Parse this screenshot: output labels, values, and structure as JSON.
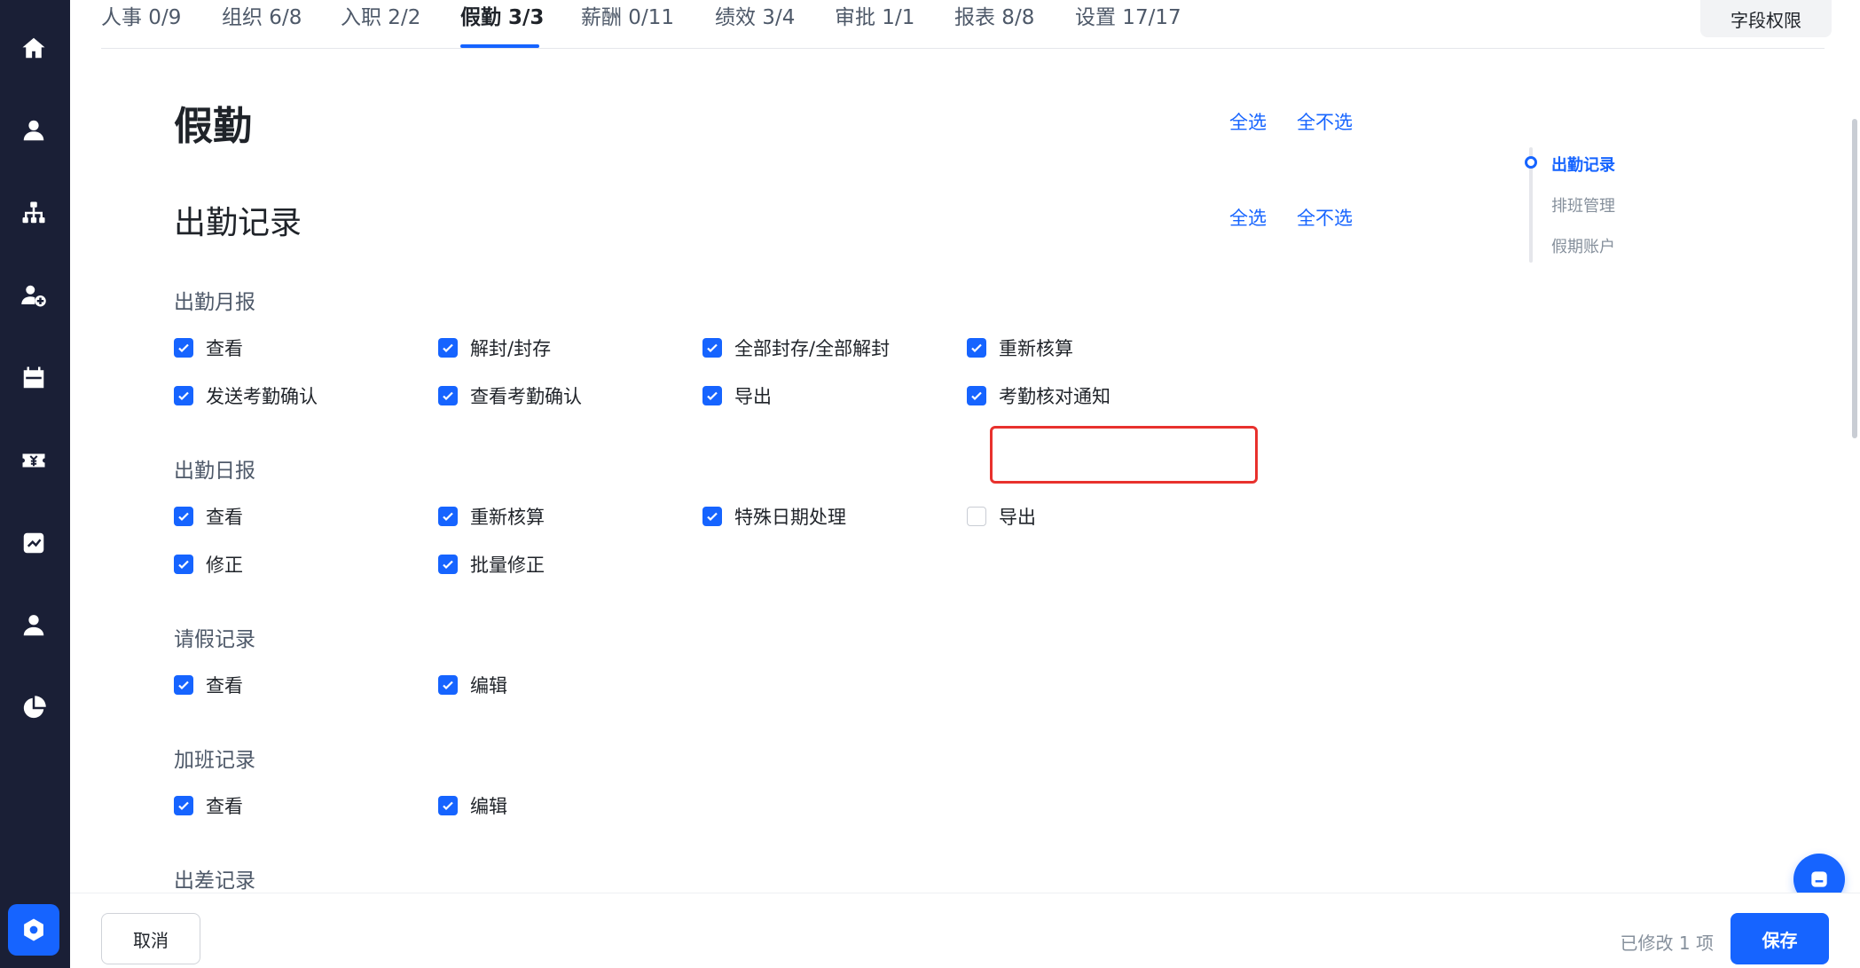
{
  "tabs": [
    {
      "label": "人事 0/9"
    },
    {
      "label": "组织 6/8"
    },
    {
      "label": "入职 2/2"
    },
    {
      "label": "假勤 3/3"
    },
    {
      "label": "薪酬 0/11"
    },
    {
      "label": "绩效 3/4"
    },
    {
      "label": "审批 1/1"
    },
    {
      "label": "报表 8/8"
    },
    {
      "label": "设置 17/17"
    }
  ],
  "active_tab": "假勤 3/3",
  "field_permission_label": "字段权限",
  "page": {
    "title": "假勤",
    "select_all": "全选",
    "select_none": "全不选"
  },
  "section": {
    "title": "出勤记录",
    "select_all": "全选",
    "select_none": "全不选"
  },
  "groups": [
    {
      "title": "出勤月报",
      "items": [
        {
          "label": "查看",
          "checked": true
        },
        {
          "label": "解封/封存",
          "checked": true
        },
        {
          "label": "全部封存/全部解封",
          "checked": true
        },
        {
          "label": "重新核算",
          "checked": true
        },
        {
          "label": "发送考勤确认",
          "checked": true
        },
        {
          "label": "查看考勤确认",
          "checked": true
        },
        {
          "label": "导出",
          "checked": true
        },
        {
          "label": "考勤核对通知",
          "checked": true
        }
      ]
    },
    {
      "title": "出勤日报",
      "items": [
        {
          "label": "查看",
          "checked": true
        },
        {
          "label": "重新核算",
          "checked": true
        },
        {
          "label": "特殊日期处理",
          "checked": true
        },
        {
          "label": "导出",
          "checked": false
        },
        {
          "label": "修正",
          "checked": true
        },
        {
          "label": "批量修正",
          "checked": true
        }
      ]
    },
    {
      "title": "请假记录",
      "items": [
        {
          "label": "查看",
          "checked": true
        },
        {
          "label": "编辑",
          "checked": true
        }
      ]
    },
    {
      "title": "加班记录",
      "items": [
        {
          "label": "查看",
          "checked": true
        },
        {
          "label": "编辑",
          "checked": true
        }
      ]
    },
    {
      "title": "出差记录",
      "items": []
    }
  ],
  "anchors": [
    {
      "label": "出勤记录",
      "active": true
    },
    {
      "label": "排班管理",
      "active": false
    },
    {
      "label": "假期账户",
      "active": false
    }
  ],
  "footer": {
    "cancel": "取消",
    "modified": "已修改 1 项",
    "save": "保存"
  },
  "colors": {
    "accent": "#1664ff",
    "sidebar": "#1a1f36",
    "highlight": "#e8312d"
  },
  "sidebar_icons": [
    "home-icon",
    "person-icon",
    "org-chart-icon",
    "person-add-icon",
    "calendar-icon",
    "payroll-yen-icon",
    "performance-chart-icon",
    "approval-person-icon",
    "report-pie-icon",
    "settings-icon"
  ]
}
